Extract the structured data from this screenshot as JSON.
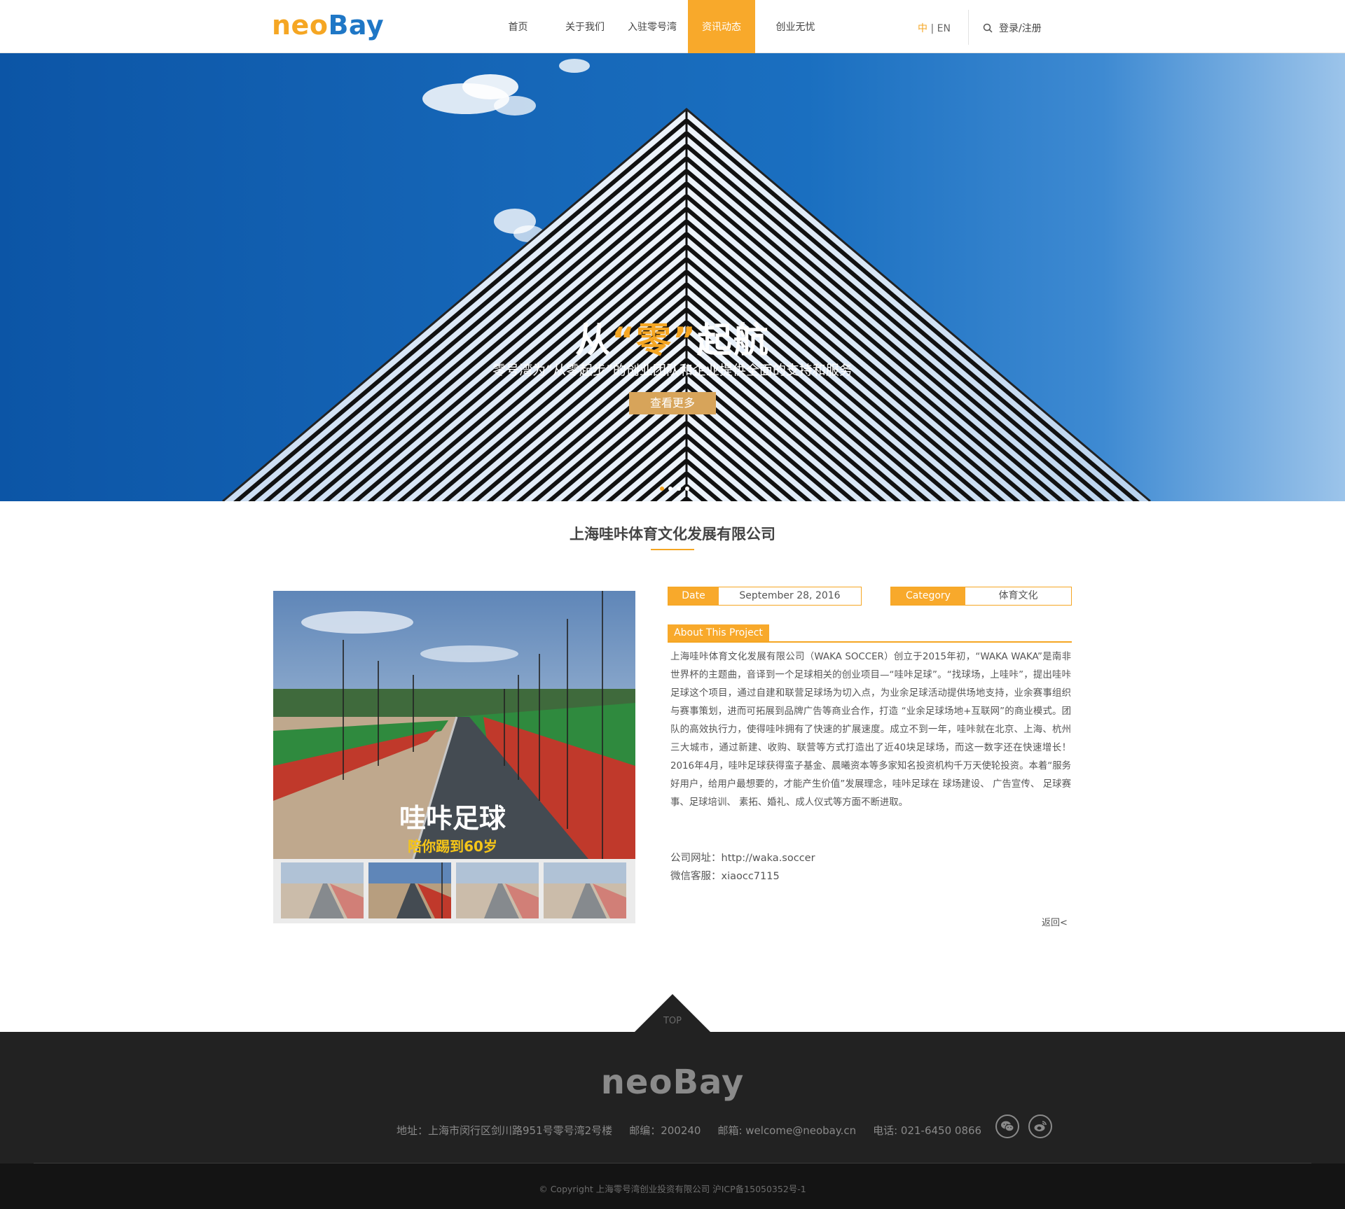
{
  "brand": {
    "logo_neo": "neo",
    "logo_bay": "Bay",
    "neo_color": "#f5a623",
    "bay_color": "#1f77c6"
  },
  "nav": {
    "items": [
      {
        "label": "首页"
      },
      {
        "label": "关于我们"
      },
      {
        "label": "入驻零号湾"
      },
      {
        "label": "资讯动态",
        "active": true
      },
      {
        "label": "创业无忧"
      }
    ],
    "lang_zh": "中",
    "lang_sep": " | ",
    "lang_en": "EN",
    "login": "登录/注册",
    "search_icon": "search-icon"
  },
  "hero": {
    "title_pre": "从",
    "title_zero": "“零”",
    "title_post": "起航",
    "subtitle": "零号湾为“从零起步”的创业团队和企业提供全面的支持和服务",
    "button": "查看更多",
    "slide_count": 4,
    "active_slide": 1
  },
  "project": {
    "title": "上海哇咔体育文化发展有限公司",
    "date_label": "Date",
    "date_value": "September 28, 2016",
    "category_label": "Category",
    "category_value": "体育文化",
    "about_label": "About This Project",
    "about_text": "上海哇咔体育文化发展有限公司（WAKA SOCCER）创立于2015年初，“WAKA WAKA”是南非世界杯的主题曲，音译到一个足球相关的创业项目—“哇咔足球”。“找球场，上哇咔”，提出哇咔足球这个项目，通过自建和联营足球场为切入点，为业余足球活动提供场地支持，业余赛事组织与赛事策划，进而可拓展到品牌广告等商业合作，打造 “业余足球场地+互联网”的商业模式。团队的高效执行力，使得哇咔拥有了快速的扩展速度。成立不到一年，哇咔就在北京、上海、杭州三大城市，通过新建、收购、联营等方式打造出了近40块足球场，而这一数字还在快速增长！2016年4月，哇咔足球获得蛮子基金、晨曦资本等多家知名投资机构千万天使轮投资。本着“服务好用户，给用户最想要的，才能产生价值”发展理念，哇咔足球在 球场建设、 广告宣传、 足球赛事、足球培训、 素拓、婚礼、成人仪式等方面不断进取。",
    "website": "公司网址：http://waka.soccer",
    "wechat": "微信客服：xiaocc7115",
    "back": "返回<",
    "photo_caption_1": "哇咔足球",
    "photo_caption_2": "陪你踢到60岁",
    "thumb_count": 4,
    "active_thumb": 2
  },
  "footer": {
    "top": "TOP",
    "logo": "neoBay",
    "address": "地址：上海市闵行区剑川路951号零号湾2号楼",
    "postcode": "邮编：200240",
    "email": "邮箱: welcome@neobay.cn",
    "phone": "电话: 021-6450 0866",
    "icons": [
      "wechat-icon",
      "weibo-icon"
    ],
    "copyright": "© Copyright 上海零号湾创业投资有限公司 沪ICP备15050352号-1"
  }
}
